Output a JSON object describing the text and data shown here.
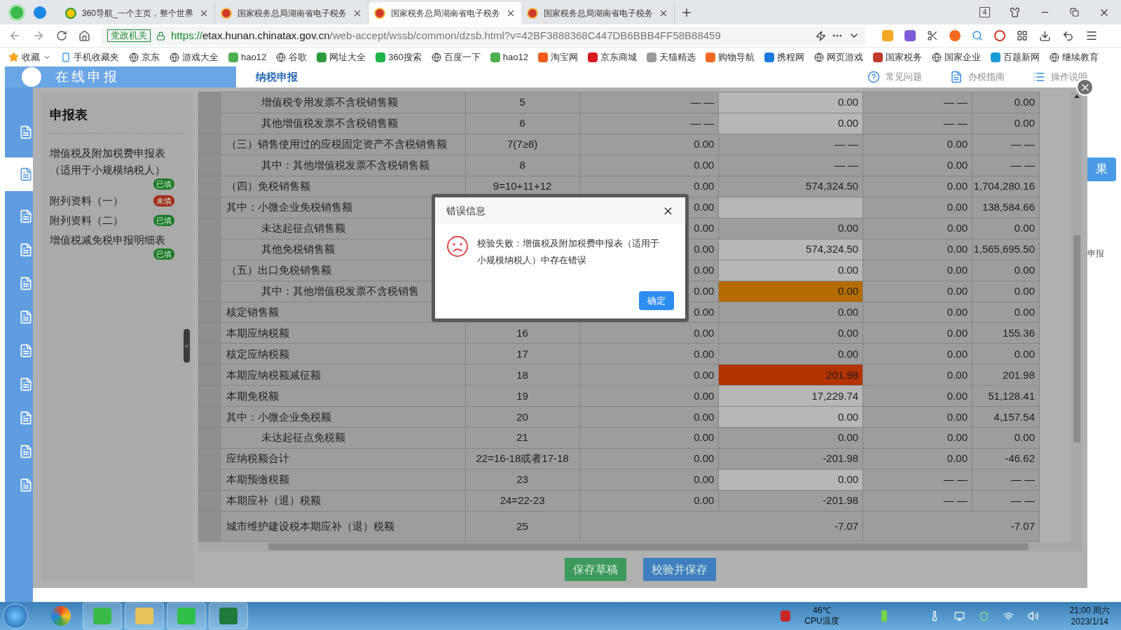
{
  "browser": {
    "tabs": [
      {
        "title": "360导航_一个主页，整个世界",
        "selected": false,
        "kind": "portal"
      },
      {
        "title": "国家税务总局湖南省电子税务",
        "selected": false,
        "kind": "emblem"
      },
      {
        "title": "国家税务总局湖南省电子税务",
        "selected": true,
        "kind": "emblem"
      },
      {
        "title": "国家税务总局湖南省电子税务",
        "selected": false,
        "kind": "emblem"
      }
    ],
    "tab_count": "4",
    "address_badge": "党政机关",
    "url_scheme": "https://",
    "url_host": "etax.hunan.chinatax.gov.cn",
    "url_path": "/web-accept/wssb/common/dzsb.html?v=42BF3888368C447DB6BBB4FF58B88459",
    "bookmarks": [
      {
        "label": "收藏",
        "kind": "star"
      },
      {
        "label": "手机收藏夹",
        "kind": "phone"
      },
      {
        "label": "京东",
        "kind": "globe"
      },
      {
        "label": "游戏大全",
        "kind": "globe"
      },
      {
        "label": "hao12",
        "kind": "logo",
        "color": "#4caf50"
      },
      {
        "label": "谷歌",
        "kind": "globe"
      },
      {
        "label": "网址大全",
        "kind": "logo",
        "color": "#2e9b3a"
      },
      {
        "label": "360搜索",
        "kind": "logo",
        "color": "#1eb44a"
      },
      {
        "label": "百度一下",
        "kind": "globe"
      },
      {
        "label": "hao12",
        "kind": "logo",
        "color": "#4caf50"
      },
      {
        "label": "淘宝网",
        "kind": "logo",
        "color": "#f05a1a"
      },
      {
        "label": "京东商城",
        "kind": "logo",
        "color": "#d71920"
      },
      {
        "label": "天猫精选",
        "kind": "logo",
        "color": "#9a9a9a"
      },
      {
        "label": "购物导航",
        "kind": "logo",
        "color": "#f26a21"
      },
      {
        "label": "携程网",
        "kind": "logo",
        "color": "#1f7ae0"
      },
      {
        "label": "网页游戏",
        "kind": "globe"
      },
      {
        "label": "国家税务",
        "kind": "logo",
        "color": "#c0392b"
      },
      {
        "label": "国家企业",
        "kind": "globe"
      },
      {
        "label": "百题新网",
        "kind": "logo",
        "color": "#1a9bd7"
      },
      {
        "label": "继续教育",
        "kind": "globe"
      }
    ]
  },
  "page": {
    "header_title": "在线申报",
    "section": "纳税申报",
    "links": [
      "常见问题",
      "办税指南",
      "操作说明"
    ],
    "side_button": "果",
    "side_text": "申报"
  },
  "modal": {
    "sidebar": {
      "title": "申报表",
      "items": [
        {
          "name": "增值税及附加税费申报表（适用于小规模纳税人）",
          "badge": "已填",
          "filled": true
        },
        {
          "name": "附列资料（一）",
          "badge": "未填",
          "filled": false
        },
        {
          "name": "附列资料（二）",
          "badge": "已填",
          "filled": true
        },
        {
          "name": "增值税减免税申报明细表",
          "badge": "已填",
          "filled": true
        }
      ]
    },
    "table": {
      "rows": [
        {
          "label": "增值税专用发票不含税销售额",
          "indented": true,
          "no": "5",
          "cells": [
            {
              "text": "— —",
              "kind": "plain"
            },
            {
              "text": "0.00",
              "kind": "input"
            },
            {
              "text": "— —",
              "kind": "plain"
            },
            {
              "text": "0.00",
              "kind": "plain"
            }
          ]
        },
        {
          "label": "其他增值税发票不含税销售额",
          "indented": true,
          "no": "6",
          "cells": [
            {
              "text": "— —",
              "kind": "plain"
            },
            {
              "text": "0.00",
              "kind": "input"
            },
            {
              "text": "— —",
              "kind": "plain"
            },
            {
              "text": "0.00",
              "kind": "plain"
            }
          ]
        },
        {
          "label": "（三）销售使用过的应税固定资产不含税销售额",
          "indented": false,
          "no": "7(7≥8)",
          "cells": [
            {
              "text": "0.00",
              "kind": "plain"
            },
            {
              "text": "— —",
              "kind": "plain"
            },
            {
              "text": "0.00",
              "kind": "plain"
            },
            {
              "text": "— —",
              "kind": "plain"
            }
          ]
        },
        {
          "label": "其中：其他增值税发票不含税销售额",
          "indented": true,
          "no": "8",
          "cells": [
            {
              "text": "0.00",
              "kind": "plain"
            },
            {
              "text": "— —",
              "kind": "plain"
            },
            {
              "text": "0.00",
              "kind": "plain"
            },
            {
              "text": "— —",
              "kind": "plain"
            }
          ]
        },
        {
          "label": "（四）免税销售额",
          "indented": false,
          "no": "9=10+11+12",
          "cells": [
            {
              "text": "0.00",
              "kind": "plain"
            },
            {
              "text": "574,324.50",
              "kind": "plain"
            },
            {
              "text": "0.00",
              "kind": "plain"
            },
            {
              "text": "1,704,280.16",
              "kind": "plain"
            }
          ]
        },
        {
          "label": "其中：小微企业免税销售额",
          "indented": false,
          "cells": [
            {
              "text": "0.00",
              "kind": "plain"
            },
            {
              "kind": "input"
            },
            {
              "text": "0.00",
              "kind": "plain"
            },
            {
              "text": "138,584.66",
              "kind": "plain"
            }
          ]
        },
        {
          "label": "未达起征点销售额",
          "indented": true,
          "cells": [
            {
              "text": "0.00",
              "kind": "plain"
            },
            {
              "text": "0.00",
              "kind": "plain"
            },
            {
              "text": "0.00",
              "kind": "plain"
            },
            {
              "text": "0.00",
              "kind": "plain"
            }
          ]
        },
        {
          "label": "其他免税销售额",
          "indented": true,
          "cells": [
            {
              "text": "0.00",
              "kind": "plain"
            },
            {
              "text": "574,324.50",
              "kind": "input"
            },
            {
              "text": "0.00",
              "kind": "plain"
            },
            {
              "text": "1,565,695.50",
              "kind": "plain"
            }
          ]
        },
        {
          "label": "（五）出口免税销售额",
          "indented": false,
          "cells": [
            {
              "text": "0.00",
              "kind": "plain"
            },
            {
              "text": "0.00",
              "kind": "input"
            },
            {
              "text": "0.00",
              "kind": "plain"
            },
            {
              "text": "0.00",
              "kind": "plain"
            }
          ]
        },
        {
          "label": "其中：其他增值税发票不含税销售",
          "indented": true,
          "cells": [
            {
              "text": "0.00",
              "kind": "plain"
            },
            {
              "text": "0.00",
              "kind": "warning"
            },
            {
              "text": "0.00",
              "kind": "plain"
            },
            {
              "text": "0.00",
              "kind": "plain"
            }
          ]
        },
        {
          "label": "核定销售额",
          "indented": false,
          "cells": [
            {
              "text": "0.00",
              "kind": "plain"
            },
            {
              "text": "0.00",
              "kind": "plain"
            },
            {
              "text": "0.00",
              "kind": "plain"
            },
            {
              "text": "0.00",
              "kind": "plain"
            }
          ]
        },
        {
          "label": "本期应纳税额",
          "indented": false,
          "no": "16",
          "cells": [
            {
              "text": "0.00",
              "kind": "plain"
            },
            {
              "text": "0.00",
              "kind": "plain"
            },
            {
              "text": "0.00",
              "kind": "plain"
            },
            {
              "text": "155.36",
              "kind": "plain"
            }
          ]
        },
        {
          "label": "核定应纳税额",
          "indented": false,
          "no": "17",
          "cells": [
            {
              "text": "0.00",
              "kind": "plain"
            },
            {
              "text": "0.00",
              "kind": "plain"
            },
            {
              "text": "0.00",
              "kind": "plain"
            },
            {
              "text": "0.00",
              "kind": "plain"
            }
          ]
        },
        {
          "label": "本期应纳税额减征额",
          "indented": false,
          "no": "18",
          "cells": [
            {
              "text": "0.00",
              "kind": "plain"
            },
            {
              "text": "201.98",
              "kind": "error"
            },
            {
              "text": "0.00",
              "kind": "plain"
            },
            {
              "text": "201.98",
              "kind": "plain"
            }
          ]
        },
        {
          "label": "本期免税额",
          "indented": false,
          "no": "19",
          "cells": [
            {
              "text": "0.00",
              "kind": "plain"
            },
            {
              "text": "17,229.74",
              "kind": "input"
            },
            {
              "text": "0.00",
              "kind": "plain"
            },
            {
              "text": "51,128.41",
              "kind": "plain"
            }
          ]
        },
        {
          "label": "其中：小微企业免税额",
          "indented": false,
          "no": "20",
          "cells": [
            {
              "text": "0.00",
              "kind": "plain"
            },
            {
              "text": "0.00",
              "kind": "input"
            },
            {
              "text": "0.00",
              "kind": "plain"
            },
            {
              "text": "4,157.54",
              "kind": "plain"
            }
          ]
        },
        {
          "label": "未达起征点免税额",
          "indented": true,
          "no": "21",
          "cells": [
            {
              "text": "0.00",
              "kind": "plain"
            },
            {
              "text": "0.00",
              "kind": "plain"
            },
            {
              "text": "0.00",
              "kind": "plain"
            },
            {
              "text": "0.00",
              "kind": "plain"
            }
          ]
        },
        {
          "label": "应纳税额合计",
          "indented": false,
          "no": "22=16-18或者17-18",
          "cells": [
            {
              "text": "0.00",
              "kind": "plain"
            },
            {
              "text": "-201.98",
              "kind": "plain"
            },
            {
              "text": "0.00",
              "kind": "plain"
            },
            {
              "text": "-46.62",
              "kind": "plain"
            }
          ]
        },
        {
          "label": "本期预缴税额",
          "indented": false,
          "no": "23",
          "cells": [
            {
              "text": "0.00",
              "kind": "plain"
            },
            {
              "text": "0.00",
              "kind": "input"
            },
            {
              "text": "— —",
              "kind": "plain"
            },
            {
              "text": "— —",
              "kind": "plain"
            }
          ]
        },
        {
          "label": "本期应补（退）税额",
          "indented": false,
          "no": "24=22-23",
          "cells": [
            {
              "text": "0.00",
              "kind": "plain"
            },
            {
              "text": "-201.98",
              "kind": "plain"
            },
            {
              "text": "— —",
              "kind": "plain"
            },
            {
              "text": "— —",
              "kind": "plain"
            }
          ]
        },
        {
          "label": "城市维护建设税本期应补（退）税额",
          "indented": false,
          "no": "25",
          "kind": "merged",
          "cells": [
            {
              "kind": "plain"
            },
            {
              "text": "-7.07",
              "kind": "plain"
            },
            {
              "kind": "plain"
            },
            {
              "text": "-7.07",
              "kind": "plain"
            }
          ]
        }
      ]
    },
    "buttons": [
      {
        "label": "保存草稿",
        "kind": "draft"
      },
      {
        "label": "校验并保存",
        "kind": "primary"
      }
    ]
  },
  "dialog": {
    "title": "错误信息",
    "message": "校验失败：增值税及附加税费申报表（适用于小规模纳税人）中存在错误",
    "button": "确定"
  },
  "taskbar": {
    "temperature": "46℃",
    "temperature_label": "CPU温度",
    "time": "21:00 周六",
    "date": "2023/1/14"
  }
}
